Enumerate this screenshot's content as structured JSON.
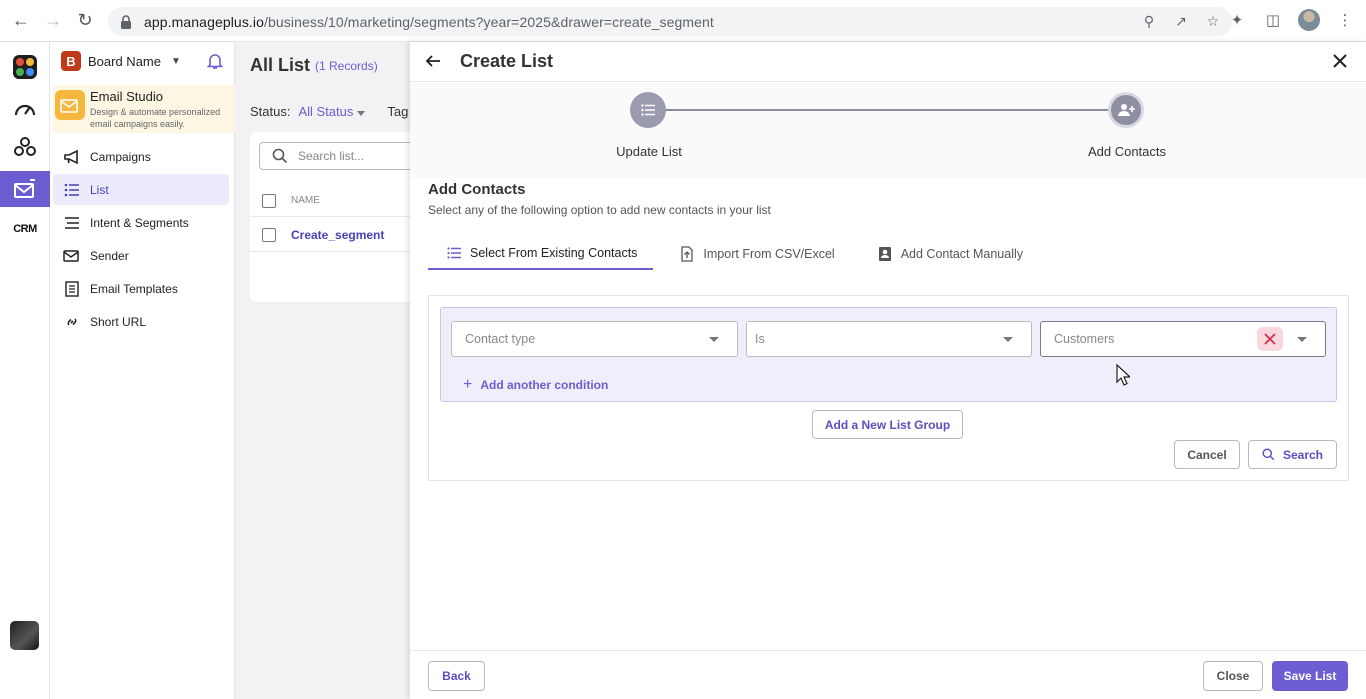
{
  "browser": {
    "url_host": "app.manageplus.io",
    "url_path": "/business/10/marketing/segments?year=2025&drawer=create_segment"
  },
  "rail": {
    "crm_label": "CRM"
  },
  "sidebar": {
    "board_badge": "B",
    "board_name": "Board Name",
    "studio_title": "Email Studio",
    "studio_desc": "Design & automate personalized email campaigns easily.",
    "items": [
      {
        "label": "Campaigns",
        "icon": "megaphone-icon"
      },
      {
        "label": "List",
        "icon": "list-icon",
        "active": true
      },
      {
        "label": "Intent & Segments",
        "icon": "segments-icon"
      },
      {
        "label": "Sender",
        "icon": "sender-icon"
      },
      {
        "label": "Email Templates",
        "icon": "template-icon"
      },
      {
        "label": "Short URL",
        "icon": "link-icon"
      }
    ]
  },
  "list_page": {
    "title": "All List",
    "count": "(1 Records)",
    "status_label": "Status:",
    "status_value": "All Status",
    "tags_label": "Tag",
    "search_placeholder": "Search list...",
    "column_name": "NAME",
    "rows": [
      "Create_segment"
    ]
  },
  "drawer": {
    "title": "Create List",
    "steps": [
      {
        "label": "Update List"
      },
      {
        "label": "Add Contacts"
      }
    ],
    "section_title": "Add Contacts",
    "section_subtitle": "Select any of the following option to add new contacts in your list",
    "tabs": [
      {
        "label": "Select From Existing Contacts",
        "active": true
      },
      {
        "label": "Import From CSV/Excel"
      },
      {
        "label": "Add Contact Manually"
      }
    ],
    "condition": {
      "field_placeholder": "Contact type",
      "operator_value": "Is",
      "value_text": "Customers",
      "add_condition_label": "Add another condition"
    },
    "add_group_label": "Add a New List Group",
    "cancel_label": "Cancel",
    "search_label": "Search",
    "footer": {
      "back_label": "Back",
      "close_label": "Close",
      "save_label": "Save List"
    }
  },
  "colors": {
    "accent": "#6c5dd3",
    "brand_badge": "#c0391b",
    "studio_bg": "#fdf6e3"
  }
}
